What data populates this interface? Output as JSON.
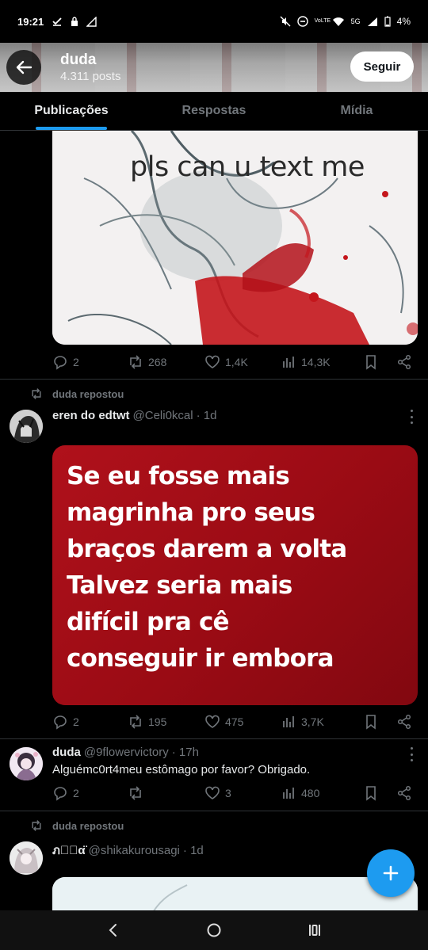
{
  "status_bar": {
    "time": "19:21",
    "battery": "4%",
    "network": "5G",
    "volte": "VoLTE"
  },
  "header": {
    "name": "duda",
    "posts_count": "4.311 posts",
    "follow_label": "Seguir"
  },
  "tabs": [
    {
      "label": "Publicações",
      "active": true
    },
    {
      "label": "Respostas",
      "active": false
    },
    {
      "label": "Mídia",
      "active": false
    }
  ],
  "posts": [
    {
      "image_caption": "pls can u text me",
      "replies": "2",
      "reposts": "268",
      "likes": "1,4K",
      "views": "14,3K"
    },
    {
      "repost_label": "duda repostou",
      "author_name": "eren do edtwt",
      "author_handle": "@Celi0kcal",
      "time": "· 1d",
      "image_text": "Se eu fosse mais\nmagrinha pro seus\nbraços darem a volta\nTalvez seria mais\ndifícil pra cê\nconseguir ir embora",
      "replies": "2",
      "reposts": "195",
      "likes": "475",
      "views": "3,7K"
    },
    {
      "author_name": "duda",
      "author_handle": "@9flowervictory",
      "time": "· 17h",
      "text": "Alguémc0rt4meu estômago por favor? Obrigado.",
      "replies": "2",
      "reposts": "",
      "likes": "3",
      "views": "480"
    },
    {
      "repost_label": "duda repostou",
      "author_name": "ภ𝓬ัα̈",
      "author_handle": "@shikakurousagi",
      "time": "· 1d"
    }
  ],
  "colors": {
    "accent": "#1d9bf0",
    "muted": "#71767b",
    "background": "#000000",
    "card_red": "#9a0b14"
  }
}
